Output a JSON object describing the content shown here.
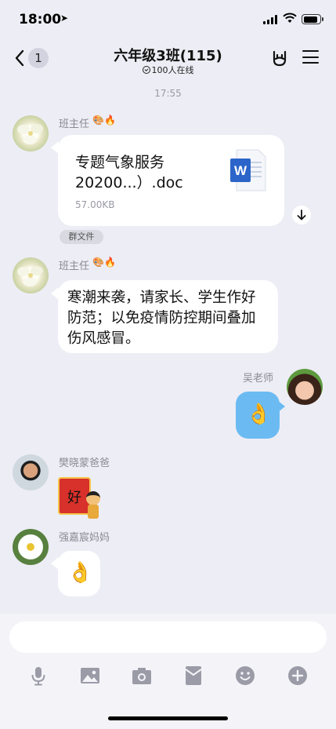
{
  "status_bar": {
    "time": "18:00"
  },
  "nav": {
    "back_count": "1",
    "title": "六年级3班(115)",
    "online": "100人在线"
  },
  "chat": {
    "timestamp": "17:55",
    "messages": [
      {
        "sender": "班主任",
        "type": "file",
        "file_name_line1": "专题气象服务",
        "file_name_line2": "20200...）.doc",
        "file_size": "57.00KB",
        "tag": "群文件"
      },
      {
        "sender": "班主任",
        "type": "text",
        "text_line1": "寒潮来袭，请家长、学生作好",
        "text_line2": "防范；以免疫情防控期间叠加",
        "text_line3": "伤风感冒。"
      },
      {
        "sender": "吴老师",
        "type": "sticker",
        "sticker": "👌"
      },
      {
        "sender": "樊晓蒙爸爸",
        "type": "sticker",
        "sticker_text": "好"
      },
      {
        "sender": "强嘉宸妈妈",
        "type": "sticker",
        "sticker": "👌"
      }
    ]
  },
  "input": {
    "placeholder": ""
  },
  "toolbar_icons": [
    "microphone-icon",
    "image-icon",
    "camera-icon",
    "red-packet-icon",
    "emoji-icon",
    "plus-icon"
  ]
}
